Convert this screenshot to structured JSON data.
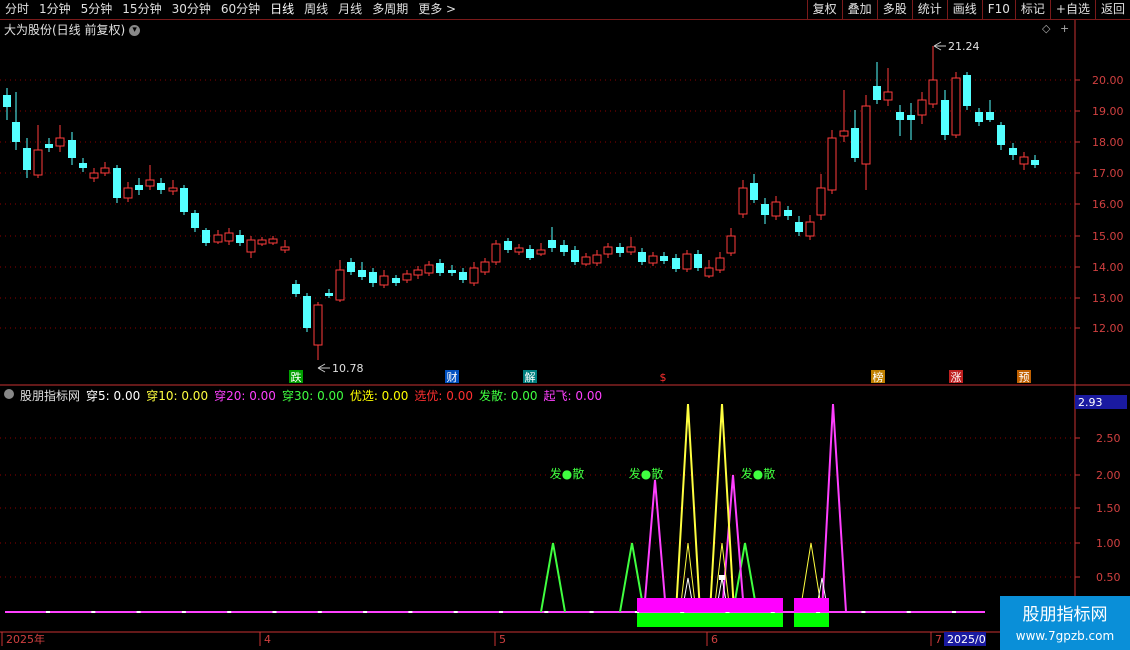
{
  "toolbar": {
    "periods": [
      "分时",
      "1分钟",
      "5分钟",
      "15分钟",
      "30分钟",
      "60分钟",
      "日线",
      "周线",
      "月线",
      "多周期",
      "更多"
    ],
    "more_arrow": ">",
    "buttons": [
      "复权",
      "叠加",
      "多股",
      "统计",
      "画线",
      "F10",
      "标记",
      "+自选",
      "返回"
    ]
  },
  "main_chart": {
    "title": "大为股份(日线 前复权)",
    "high_label": "21.24",
    "low_label": "10.78",
    "y_ticks": [
      "20.00",
      "19.00",
      "18.00",
      "17.00",
      "16.00",
      "15.00",
      "14.00",
      "13.00",
      "12.00"
    ],
    "markers": [
      {
        "text": "跌",
        "color": "#ffffff",
        "bg": "#00a000"
      },
      {
        "text": "财",
        "color": "#ffffff",
        "bg": "#0050c0"
      },
      {
        "text": "解",
        "color": "#ffffff",
        "bg": "#008080"
      },
      {
        "text": "$",
        "color": "#ff3030",
        "bg": ""
      },
      {
        "text": "榜",
        "color": "#ffffff",
        "bg": "#c08000"
      },
      {
        "text": "涨",
        "color": "#ffffff",
        "bg": "#c02020"
      },
      {
        "text": "预",
        "color": "#ffffff",
        "bg": "#c06000"
      }
    ],
    "colors": {
      "up": "#ff3c3c",
      "down": "#54ffff",
      "grid": "#8b0000",
      "axis": "#c83232"
    }
  },
  "indicator": {
    "name": "股朋指标网",
    "items": [
      {
        "label": "穿5:",
        "value": "0.00",
        "color": "#ffffff"
      },
      {
        "label": "穿10:",
        "value": "0.00",
        "color": "#ffff40"
      },
      {
        "label": "穿20:",
        "value": "0.00",
        "color": "#ff40ff"
      },
      {
        "label": "穿30:",
        "value": "0.00",
        "color": "#40ff40"
      },
      {
        "label": "优选:",
        "value": "0.00",
        "color": "#ffff00"
      },
      {
        "label": "选优:",
        "value": "0.00",
        "color": "#ff3030"
      },
      {
        "label": "发散:",
        "value": "0.00",
        "color": "#40ff40"
      },
      {
        "label": "起飞:",
        "value": "0.00",
        "color": "#ff40ff"
      }
    ],
    "current_value": "2.93",
    "y_ticks": [
      "2.50",
      "2.00",
      "1.50",
      "1.00",
      "0.50"
    ],
    "labels": [
      "发●散",
      "发●散",
      "发●散"
    ]
  },
  "x_axis": {
    "labels": [
      "2025年",
      "4",
      "5",
      "6",
      "7"
    ],
    "last_label": "2025/0"
  },
  "watermark": {
    "line1": "股朋指标网",
    "line2": "www.7gpzb.com"
  }
}
